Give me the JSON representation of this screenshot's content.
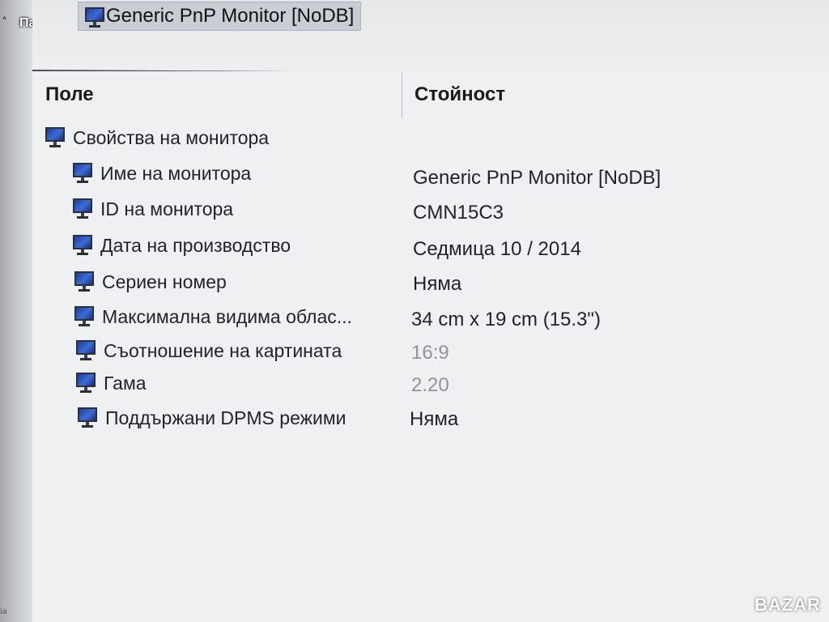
{
  "overlay": {
    "user_label": "Пацо",
    "brand": "BAZAR"
  },
  "left_strip": {
    "fragment": "ia"
  },
  "title": {
    "selected_node": "Generic PnP Monitor [NoDB]"
  },
  "table": {
    "headers": {
      "field": "Поле",
      "value": "Стойност"
    },
    "group": {
      "label": "Свойства на монитора"
    },
    "rows": [
      {
        "field": "Име на монитора",
        "value": "Generic PnP Monitor [NoDB]"
      },
      {
        "field": "ID на монитора",
        "value": "CMN15C3"
      },
      {
        "field": "Дата на производство",
        "value": "Седмица 10 / 2014"
      },
      {
        "field": "Сериен номер",
        "value": "Няма"
      },
      {
        "field": "Максимална видима облас...",
        "value": "34 cm x 19 cm (15.3\")"
      },
      {
        "field": "Съотношение на картината",
        "value": "16:9"
      },
      {
        "field": "Гама",
        "value": "2.20"
      },
      {
        "field": "Поддържани DPMS режими",
        "value": "Няма"
      }
    ]
  },
  "icons": {
    "row_icon": "monitor-icon"
  }
}
